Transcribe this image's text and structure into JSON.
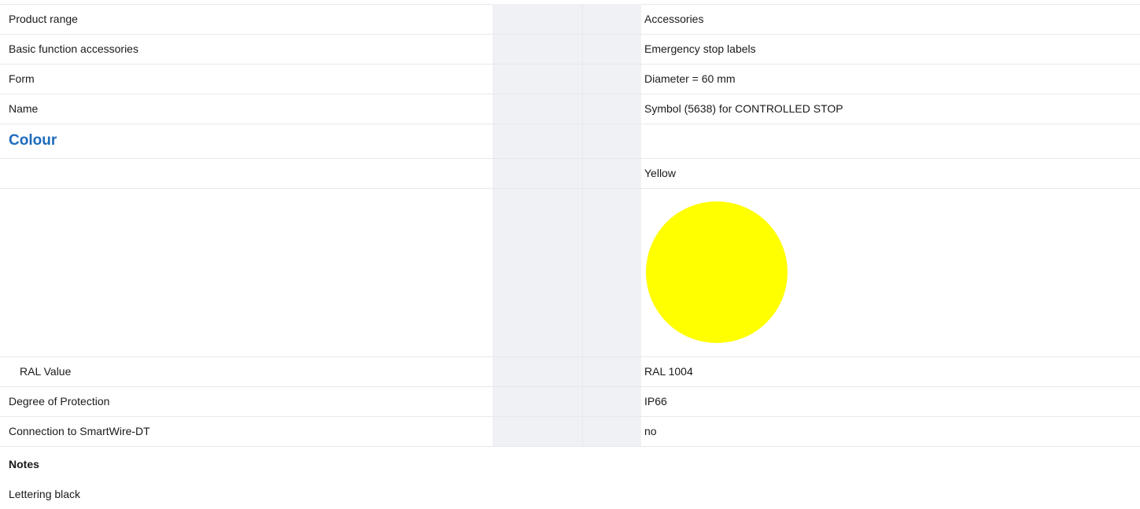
{
  "rows": [
    {
      "label": "Product range",
      "value": "Accessories"
    },
    {
      "label": "Basic function accessories",
      "value": "Emergency stop labels"
    },
    {
      "label": "Form",
      "value": "Diameter = 60 mm"
    },
    {
      "label": "Name",
      "value": "Symbol (5638) for CONTROLLED STOP"
    }
  ],
  "colour_section": {
    "title": "Colour",
    "colour_name": "Yellow",
    "swatch_color": "#ffff00",
    "ral_label": "RAL Value",
    "ral_value": "RAL 1004"
  },
  "rows_after": [
    {
      "label": "Degree of Protection",
      "value": "IP66"
    },
    {
      "label": "Connection to SmartWire-DT",
      "value": "no"
    }
  ],
  "notes": {
    "title": "Notes",
    "text": "Lettering black"
  },
  "colors": {
    "accent": "#1e6bbd",
    "gray_column": "#f0f1f4",
    "divider": "#e6e8ec"
  }
}
